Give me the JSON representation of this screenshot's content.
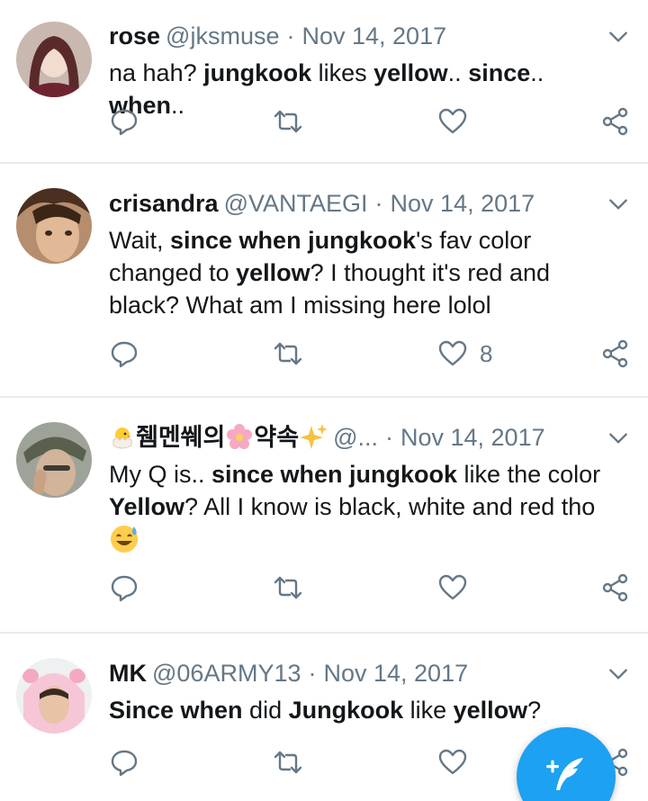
{
  "tweets": [
    {
      "name": "rose",
      "handle": "@jksmuse",
      "date": "Nov 14, 2017",
      "text_parts": [
        "na hah? ",
        "jungkook",
        " likes ",
        "yellow",
        ".. ",
        "since",
        ".. ",
        "when",
        ".."
      ],
      "likes": ""
    },
    {
      "name": "crisandra",
      "handle": "@VANTAEGI",
      "date": "Nov 14, 2017",
      "text_parts": [
        "Wait, ",
        "since when jungkook",
        "'s fav color changed to ",
        "yellow",
        "? I thought it's red and black? What am I missing here lolol"
      ],
      "likes": "8"
    },
    {
      "name": "쥄멘쒜의",
      "name2": "약속",
      "handle": "@...",
      "date": "Nov 14, 2017",
      "text_parts": [
        "My Q is.. ",
        "since when jungkook",
        " like the color ",
        "Yellow",
        "? All I know is black, white and red tho "
      ],
      "likes": ""
    },
    {
      "name": "MK",
      "handle": "@06ARMY13",
      "date": "Nov 14, 2017",
      "text_parts": [
        "Since when",
        " did ",
        "Jungkook",
        " like ",
        "yellow",
        "?"
      ],
      "likes": ""
    }
  ],
  "icons": {
    "reply": "reply-icon",
    "retweet": "retweet-icon",
    "like": "heart-icon",
    "share": "share-icon",
    "caret": "chevron-down-icon",
    "compose": "compose-tweet-icon"
  },
  "colors": {
    "accent": "#1da1f2",
    "icon_gray": "#657786",
    "divider": "#e6ecf0"
  }
}
